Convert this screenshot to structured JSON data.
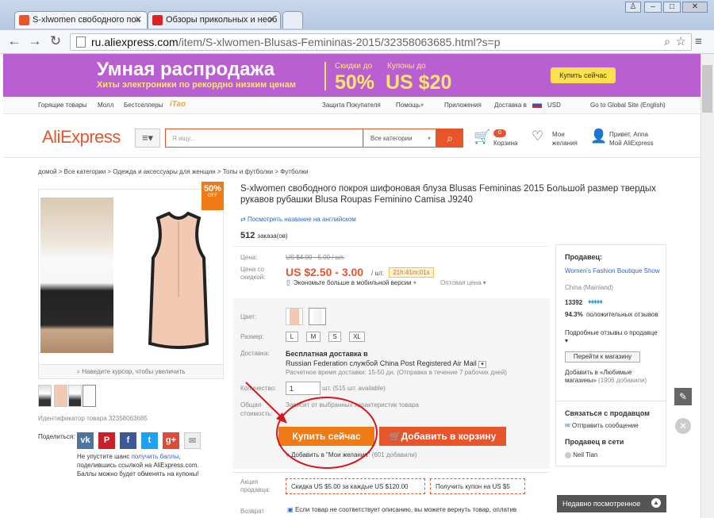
{
  "browser": {
    "tabs": [
      {
        "title": "S-xlwomen свободного пок",
        "active": true
      },
      {
        "title": "Обзоры прикольных и необ",
        "active": false
      }
    ],
    "url_domain": "ru.aliexpress.com",
    "url_path": "/item/S-xlwomen-Blusas-Femininas-2015/32358063685.html?s=p",
    "window_buttons": [
      "user-icon",
      "minimize-icon",
      "maximize-icon",
      "close-icon"
    ]
  },
  "banner": {
    "title": "Умная распродажа",
    "subtitle": "Хиты электроники по рекордно низким ценам",
    "discount_label": "Скидки до",
    "discount_value": "50%",
    "coupon_label": "Купоны до",
    "coupon_value": "US $20",
    "button": "Купить сейчас"
  },
  "topnav": {
    "left": [
      "Горящие товары",
      "Молл",
      "Бестселлеры",
      "iTao"
    ],
    "right": [
      "Защита Покупателя",
      "Помощь",
      "Приложения",
      "Доставка в",
      "USD",
      "Go to Global Site (English)"
    ]
  },
  "header": {
    "logo": "AliExpress",
    "search_placeholder": "Я ищу...",
    "all_categories": "Все категории",
    "cart_count": "0",
    "cart_label": "Корзина",
    "wish_label1": "Мои",
    "wish_label2": "желания",
    "greeting": "Привет, Anna",
    "my_ali": "Мой AliExpress"
  },
  "breadcrumb": "домой > Все категории > Одежда и аксессуары для женщин > Топы и футболки > Футболки",
  "gallery": {
    "badge_value": "50%",
    "badge_sub": "OFF",
    "hint": "Наведите курсор, чтобы увеличить",
    "product_id": "Идентификатор товара 32358063685",
    "share_label": "Поделиться:",
    "share_text_before": "Не упустите шанс ",
    "share_link": "получить баллы",
    "share_text_after": ", поделившись ссылкой на AliExpress.com. Баллы можно будет обменять на купоны!"
  },
  "product": {
    "title": "S-xlwomen свободного покроя шифоновая блуза Blusas Femininas 2015 Большой размер твердых рукавов рубашки Blusa Roupas Feminino Camisa J9240",
    "view_english": "Посмотреть название на английском",
    "orders_count": "512",
    "orders_label": "заказа(ов)",
    "price_label": "Цена:",
    "old_price": "US $4.00 - 5.00 / шт.",
    "discount_label": "Цена со скидкой:",
    "price": "US $2.50 - 3.00",
    "unit": "/ шт.",
    "timer": "21h:41m:01s",
    "mobile_save": "Экономьте больше в мобильной версии",
    "wholesale": "Оптовая цена",
    "color_label": "Цвет:",
    "size_label": "Размер:",
    "sizes": [
      "L",
      "M",
      "S",
      "XL"
    ],
    "shipping_label": "Доставка:",
    "shipping_free": "Бесплатная доставка в",
    "shipping_service": "Russian Federation службой China Post Registered Air Mail",
    "shipping_time": "Расчетное время доставки: 15-50 дн. (Отправка в течение 7 рабочих дней)",
    "qty_label": "Количество:",
    "qty_value": "1",
    "qty_available": "шт. (515 шт. available)",
    "total_label1": "Общая",
    "total_label2": "стоимость:",
    "total_value": "Зависит от выбранных характеристик товара",
    "buy_now": "Купить сейчас",
    "add_to_cart": "Добавить в корзину",
    "wishlist": "Добавить в \"Мои желания\"",
    "wishlist_count": "(601 добавили)",
    "promo_label1": "Акция",
    "promo_label2": "продавца:",
    "promo1": "Скидка US $5.00 за каждые US $120.00",
    "promo2": "Получить купон на US $5",
    "return_label": "Возврат",
    "return_text": "Если товар не соответствует описанию, вы можете вернуть товар, оплатив"
  },
  "seller": {
    "heading": "Продавец:",
    "name": "Women's Fashion Boutique Show",
    "country": "China (Mainland)",
    "rating_num": "13392",
    "positive_pct": "94.3%",
    "positive_label": "положительных отзывов",
    "detailed_label": "Подробные отзывы о продавце",
    "go_store": "Перейти к магазину",
    "fav_text": "Добавить в «Любимые магазины»",
    "fav_count": "(1906 добавили)",
    "contact_heading": "Связаться с продавцом",
    "send_message": "Отправить сообщение",
    "online_heading": "Продавец в сети",
    "online_name": "Neil Tian",
    "recent": "Недавно посмотренное"
  },
  "colors": {
    "accent": "#e8552a",
    "buy_button": "#f07b16",
    "banner_bg": "#b95fd1",
    "banner_text": "#ffe66a",
    "annotation": "#d8141c"
  }
}
